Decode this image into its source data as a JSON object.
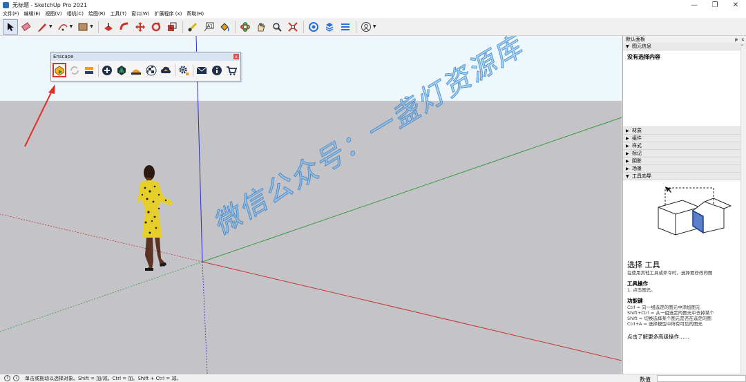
{
  "window": {
    "title": "无标题 - SketchUp Pro 2021",
    "controls": [
      "—",
      "❐",
      "✕"
    ]
  },
  "menu": [
    "文件(F)",
    "编辑(E)",
    "视图(V)",
    "相机(C)",
    "绘图(R)",
    "工具(T)",
    "窗口(W)",
    "扩展程序 (x)",
    "帮助(H)"
  ],
  "toolbar": {
    "tools": [
      "select-icon",
      "eraser-icon",
      "pencil-icon",
      "arc-icon",
      "rectangle-icon",
      "push-pull-icon",
      "follow-me-icon",
      "move-icon",
      "rotate-icon",
      "scale-icon",
      "tape-measure-icon",
      "text-icon",
      "orbit-icon",
      "pan-icon",
      "zoom-icon",
      "zoom-extents-icon",
      "warehouse-icon",
      "extension-warehouse-icon",
      "layout-icon",
      "styles-icon",
      "account-icon"
    ]
  },
  "enscape": {
    "title": "Enscape",
    "close": "x"
  },
  "watermark": "微信公众号：一盏灯资源库",
  "panel": {
    "title": "默认面板",
    "entity_info": {
      "label": "图元信息",
      "content": "没有选择内容"
    },
    "trays": [
      "材质",
      "组件",
      "样式",
      "标记",
      "阴影",
      "场景",
      "工具向导"
    ],
    "instructor": {
      "tool_name": "选择 工具",
      "tool_desc": "在使用其他工具或命令时，选择要修改的图",
      "ops_heading": "工具操作",
      "ops": [
        "1. 点击图元。"
      ],
      "keys_heading": "功能键",
      "keys": [
        "Ctrl = 向一组选定的图元中添加图元",
        "Shift+Ctrl = 从一组选定的图元中去掉某个",
        "Shift = 切换选择某个图元是否在选定的图",
        "Ctrl+A = 选择模型中所有可见的图元"
      ],
      "more_link": "点击了解更多高级操作……"
    }
  },
  "status": {
    "text": "单击或拖动以选择对象。Shift = 加/减。Ctrl = 加。Shift + Ctrl = 减。",
    "measure_label": "数值",
    "measure_value": ""
  },
  "colors": {
    "sky": "#eef7fc",
    "ground": "#c3c3c8",
    "highlight": "#e0302a",
    "axis_red": "#c43434",
    "axis_green": "#3a9a3a",
    "axis_blue": "#2c2cc8"
  }
}
